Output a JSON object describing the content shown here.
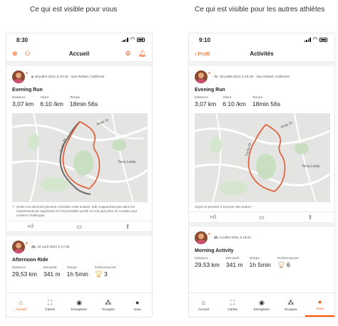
{
  "captions": {
    "left": "Ce qui est visible pour vous",
    "right": "Ce qui est visible pour les autres athlètes"
  },
  "left": {
    "status_time": "8:30",
    "nav_title": "Accueil",
    "card1": {
      "meta": "28 juillet 2021 à 19:19 · San Rafael, Californie",
      "title": "Evening Run",
      "stats": [
        {
          "label": "Distance",
          "value": "3,07 km"
        },
        {
          "label": "Allure",
          "value": "6:10 /km"
        },
        {
          "label": "Temps",
          "value": "18min 56s"
        }
      ],
      "map_labels": {
        "street1": "Arias St",
        "street2": "Terra Linda",
        "street3": "Trellis Dr"
      },
      "notice": "Seuls vos abonnés peuvent consulter cette activité. Elle n'apparaîtra pas dans les classements de segments et il est possible qu'elle ne soit pas prise en compte pour certains challenges."
    },
    "card2": {
      "meta": "10 août 2021 à 17:45",
      "title": "Afternoon Ride",
      "stats": [
        {
          "label": "Distance",
          "value": "29,53 km"
        },
        {
          "label": "Dénivelé",
          "value": "341 m"
        },
        {
          "label": "Temps",
          "value": "1h 5min"
        },
        {
          "label": "Performances",
          "value": "3"
        }
      ]
    },
    "tabs": [
      "Accueil",
      "Cartes",
      "Enregistrer",
      "Groupes",
      "Vous"
    ]
  },
  "right": {
    "status_time": "9:10",
    "back_label": "Profil",
    "nav_title": "Activités",
    "card1": {
      "meta": "28 juillet 2021 à 19:19 · San Rafael, Californie",
      "title": "Evening Run",
      "stats": [
        {
          "label": "Distance",
          "value": "3,07 km"
        },
        {
          "label": "Allure",
          "value": "6:10 /km"
        },
        {
          "label": "Temps",
          "value": "18min 56s"
        }
      ],
      "map_labels": {
        "street1": "Arias St",
        "street2": "Terra Linda",
        "street3": "Trellis Dr"
      },
      "kudos_prompt": "Soyez le premier à envoyer des kudos !"
    },
    "card2": {
      "meta": "6 juillet 2021 à 19:41",
      "title": "Morning Activity",
      "stats": [
        {
          "label": "Distance",
          "value": "29,53 km"
        },
        {
          "label": "Dénivelé",
          "value": "341 m"
        },
        {
          "label": "Temps",
          "value": "1h 5min"
        },
        {
          "label": "Performances",
          "value": "6"
        }
      ]
    },
    "tabs": [
      "Accueil",
      "Cartes",
      "Enregistrer",
      "Groupes",
      "Vous"
    ]
  },
  "colors": {
    "accent": "#fc5200",
    "route": "#e4572e"
  },
  "icons": [
    "plus-icon",
    "users-icon",
    "gear-icon",
    "bell-icon",
    "chevron-left-icon",
    "lock-icon",
    "thumbs-up-icon",
    "comment-icon",
    "share-icon",
    "home-icon",
    "map-icon",
    "record-icon",
    "groups-icon",
    "profile-icon"
  ]
}
